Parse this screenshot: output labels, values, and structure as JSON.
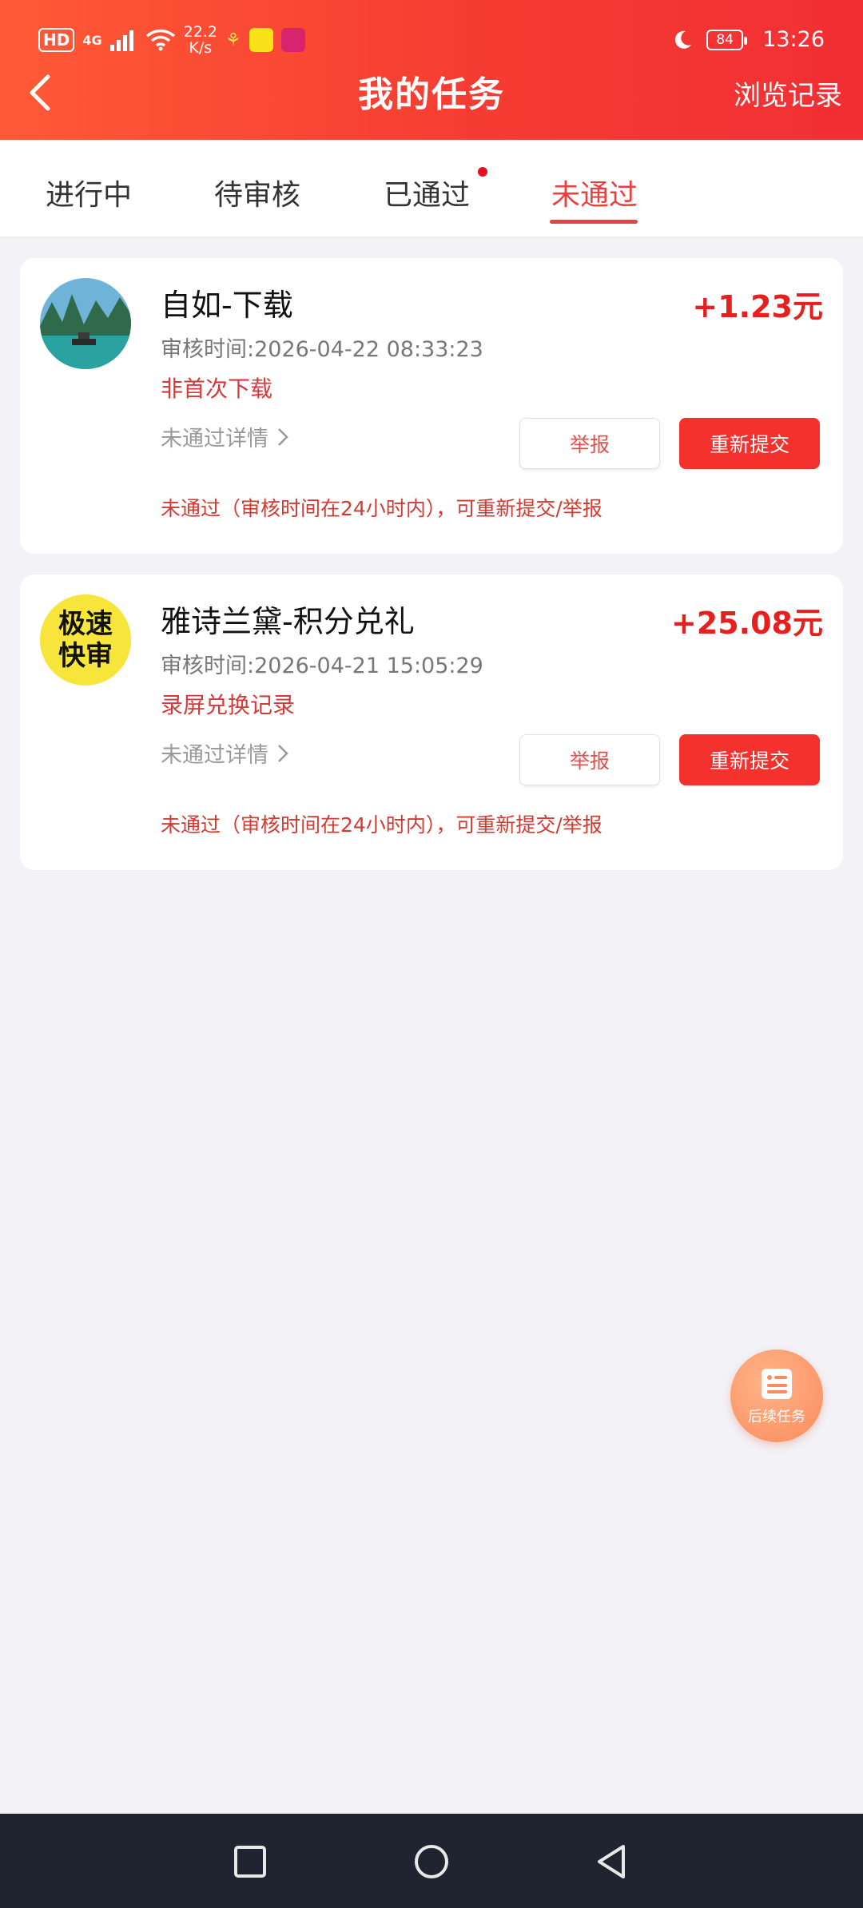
{
  "status_bar": {
    "hd": "HD",
    "net": "4G",
    "speed_value": "22.2",
    "speed_unit": "K/s",
    "battery": "84",
    "time": "13:26"
  },
  "header": {
    "title": "我的任务",
    "history_link": "浏览记录"
  },
  "tabs": [
    {
      "label": "进行中"
    },
    {
      "label": "待审核"
    },
    {
      "label": "已通过"
    },
    {
      "label": "未通过",
      "active": true
    }
  ],
  "tasks": [
    {
      "title": "自如-下载",
      "amount": "+1.23元",
      "review_time": "审核时间:2026-04-22 08:33:23",
      "reason": "非首次下载",
      "detail_link": "未通过详情",
      "report_label": "举报",
      "resubmit_label": "重新提交",
      "note": "未通过（审核时间在24小时内），可重新提交/举报"
    },
    {
      "title": "雅诗兰黛-积分兑礼",
      "amount": "+25.08元",
      "review_time": "审核时间:2026-04-21 15:05:29",
      "reason": "录屏兑换记录",
      "detail_link": "未通过详情",
      "report_label": "举报",
      "resubmit_label": "重新提交",
      "note": "未通过（审核时间在24小时内），可重新提交/举报",
      "avatar_text_top": "极速",
      "avatar_text_bottom": "快审"
    }
  ],
  "float_button": {
    "label": "后续任务",
    "icon": "document-icon"
  },
  "colors": {
    "accent": "#f5312e",
    "header_start": "#ff5a36",
    "header_end": "#f22f33"
  }
}
